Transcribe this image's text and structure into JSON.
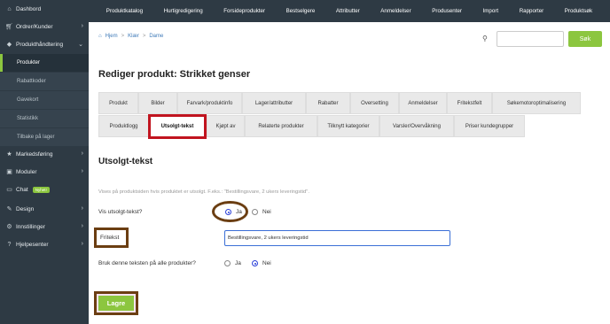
{
  "sidebar": {
    "items": [
      {
        "label": "Dashbord",
        "icon": "home-icon"
      },
      {
        "label": "Ordrer/Kunder",
        "icon": "cart-icon"
      },
      {
        "label": "Produkthåndtering",
        "icon": "tag-icon"
      }
    ],
    "subitems": [
      "Produkter",
      "Rabattkoder",
      "Gavekort",
      "Statistikk",
      "Tilbake på lager"
    ],
    "items2": [
      {
        "label": "Markedsføring",
        "icon": "star-icon"
      },
      {
        "label": "Moduler",
        "icon": "puzzle-icon"
      },
      {
        "label": "Chat",
        "icon": "chat-icon",
        "badge": "Nyhet!"
      },
      {
        "label": "Design",
        "icon": "pencil-icon"
      },
      {
        "label": "Innstillinger",
        "icon": "gear-icon"
      },
      {
        "label": "Hjelpesenter",
        "icon": "help-icon"
      }
    ]
  },
  "topnav": [
    "Produktkatalog",
    "Hurtigredigering",
    "Forsideprodukter",
    "Bestselgere",
    "Attributter",
    "Anmeldelser",
    "Produsenter",
    "Import",
    "Rapporter",
    "Produktsøk"
  ],
  "breadcrumb": {
    "home": "Hjem",
    "level1": "Klær",
    "level2": "Dame",
    "sep": ">"
  },
  "search": {
    "button": "Søk",
    "placeholder": ""
  },
  "page_title": "Rediger produkt: Strikket genser",
  "tabs_row1": [
    "Produkt",
    "Bilder",
    "Farvark/produktinfo",
    "Lager/attributter",
    "Rabatter",
    "Oversetting",
    "Anmeldelser",
    "Fritekstfelt",
    "Søkemotoroptimalisering"
  ],
  "tabs_row2": [
    "Produktlogg",
    "Utsolgt-tekst",
    "Kjøpt av",
    "Relaterte produkter",
    "Tilknytt kategorier",
    "Varsler/Overvåkning",
    "Priser kundegrupper"
  ],
  "section_title": "Utsolgt-tekst",
  "help_text": "Vises på produktsiden hvis produktet er utsolgt. F.eks.: \"Bestillingsvare, 2 ukers leveringstid\".",
  "show_label": "Vis utsolgt-tekst?",
  "freetext_label": "Fritekst",
  "freetext_value": "Bestillingsvare, 2 ukers leveringstid",
  "apply_all_label": "Bruk denne teksten på alle produkter?",
  "yes": "Ja",
  "no": "Nei",
  "save_label": "Lagre",
  "colors": {
    "accent": "#8cc63f",
    "sidebar": "#2e3a44",
    "highlight": "#c1141f",
    "annotation": "#6b3e12"
  }
}
